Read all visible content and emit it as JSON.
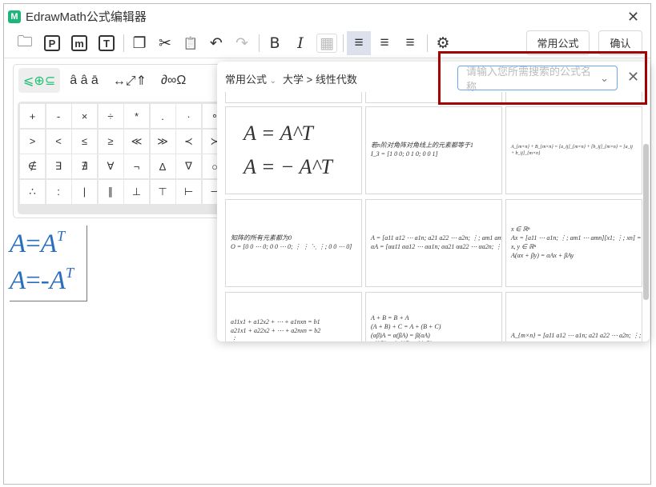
{
  "window": {
    "title": "EdrawMath公式编辑器",
    "logo": "M",
    "close": "✕"
  },
  "toolbar": {
    "icons": [
      "open-file-icon",
      "export-pdf-icon",
      "export-image-icon",
      "export-text-icon",
      "copy-icon",
      "cut-icon",
      "paste-icon",
      "undo-icon",
      "redo-icon",
      "bold-icon",
      "italic-icon",
      "color-icon",
      "align-left-icon",
      "align-center-icon",
      "align-right-icon",
      "settings-icon"
    ],
    "glyphs": {
      "open": "🗀",
      "pdf": "P",
      "img": "m",
      "txt": "T",
      "copy": "❐",
      "cut": "✂",
      "paste": "📋",
      "undo": "↶",
      "redo": "↷",
      "bold": "B",
      "italic": "I",
      "color": "▦",
      "left": "≡",
      "center": "≡",
      "right": "≡",
      "gear": "⚙"
    },
    "common_formula_label": "常用公式",
    "confirm_label": "确认"
  },
  "palette": {
    "tabs": [
      "⩽⊕⊆",
      "â â ā",
      "↔⤢⇑",
      "∂∞Ω"
    ],
    "symbols": [
      "+",
      "-",
      "×",
      "÷",
      "*",
      ".",
      "·",
      "∘",
      ">",
      "<",
      "≤",
      "≥",
      "≪",
      "≫",
      "≺",
      "≻",
      "∉",
      "∃",
      "∄",
      "∀",
      "¬",
      "∆",
      "∇",
      "○",
      "∴",
      ":",
      "|",
      "∥",
      "⊥",
      "⊤",
      "⊢",
      "⊣"
    ]
  },
  "editor": {
    "lines": [
      {
        "lhs": "A",
        "op": "=",
        "rhs": "A",
        "sup": "T"
      },
      {
        "lhs": "A",
        "op": "=-",
        "rhs": "A",
        "sup": "T"
      }
    ]
  },
  "popup": {
    "category": "常用公式",
    "breadcrumb": "大学 > 线性代数",
    "search_placeholder": "请输入您所需搜索的公式名称",
    "close": "✕",
    "cards": [
      "A = A^T\nA = − A^T",
      "若n阶对角阵对角线上的元素都等于1\nI_3 = [1 0 0; 0 1 0; 0 0 1]",
      "A_{m×n} + B_{m×n} = [a_ij]_{m×n} + [b_ij]_{m×n} = [a_ij + b_ij]_{m×n}",
      "知阵的所有元素都为0\nO = [0 0 ⋯ 0; 0 0 ⋯ 0; ⋮ ⋮ ⋱ ⋮; 0 0 ⋯ 0]",
      "A = [a11 a12 ⋯ a1n; a21 a22 ⋯ a2n; ⋮; am1 am2 ⋯ amn]\nαA = [αa11 αa12 ⋯ αa1n; αa21 αa22 ⋯ αa2n; ⋮; αam1 αam2 ⋯ αamn]",
      "x ∈ ℝⁿ\nAx = [a11 ⋯ a1n; ⋮; am1 ⋯ amn][x1; ⋮; xn] = [a11x1+⋯+a1nxn; ⋮; am1x1+⋯+amnxn] ∈ ℝᵐ\nx, y ∈ ℝⁿ\nA(αx + βy) = αAx + βAy",
      "a11x1 + a12x2 + ⋯ + a1nxn = b1\na21x1 + a22x2 + ⋯ + a2nxn = b2\n⋮\nam1x1 + am2x2 + ⋯ + amnxn = bm",
      "A + B = B + A\n(A + B) + C = A + (B + C)\n(αβ)A = α(βA) = β(αA)\nα(AB) = (αA)B = A(αB)\n(AB)C = A(BC) = ABC",
      "A_{m×n} = [a11 a12 ⋯ a1n; a21 a22 ⋯ a2n; ⋮; am1 am2 ⋯ amn]"
    ]
  },
  "highlight_color": "#a30000",
  "accent": "#1dbf73",
  "formula_color": "#2a6ebf"
}
